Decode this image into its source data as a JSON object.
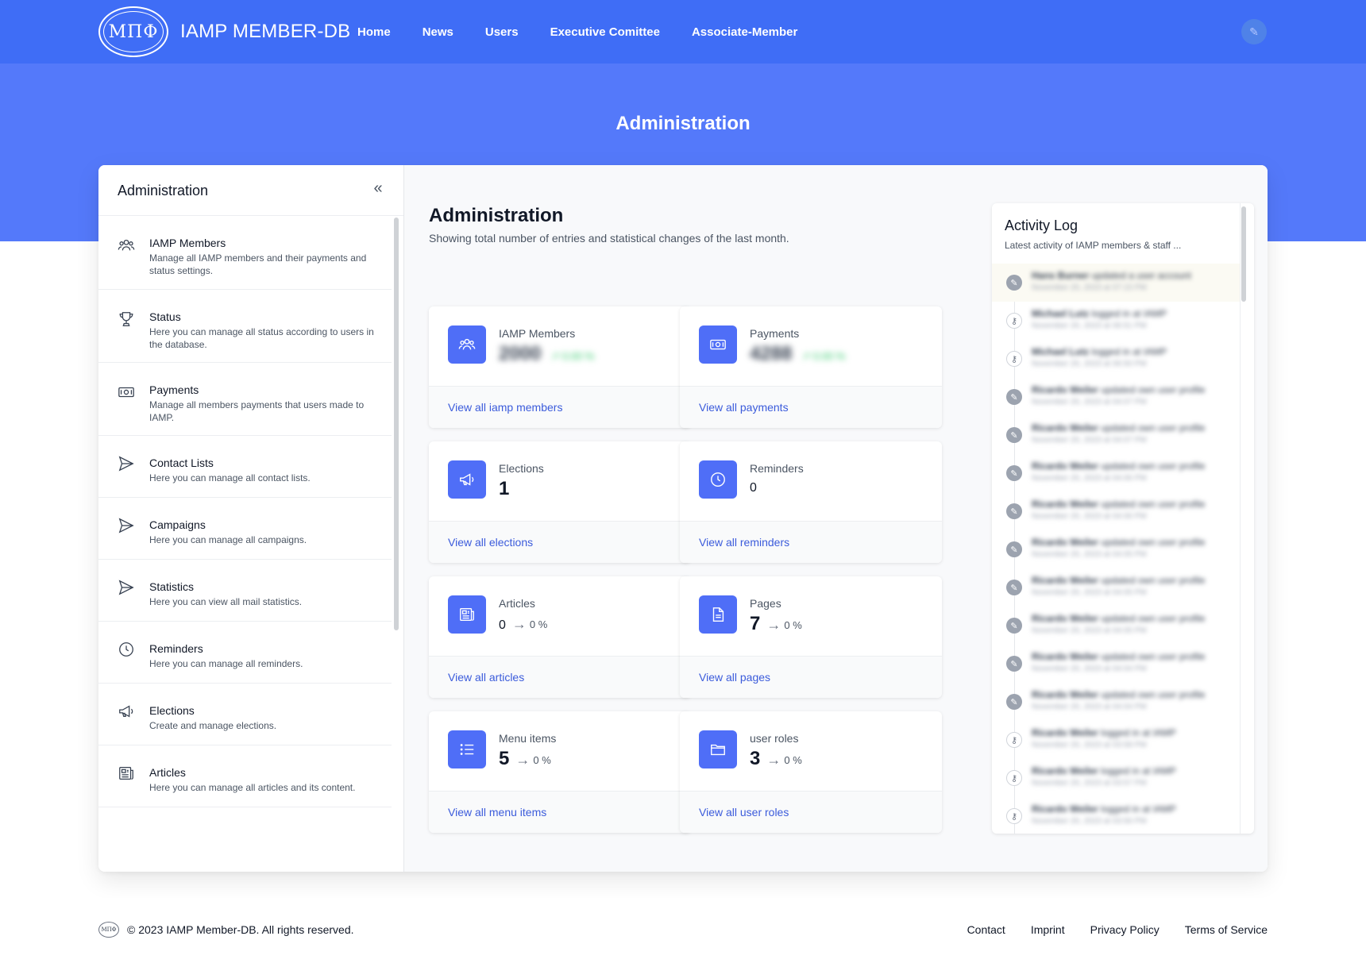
{
  "header": {
    "logo_text": "ΜΠΦ",
    "brand": "IAMP MEMBER-DB",
    "nav": [
      "Home",
      "News",
      "Users",
      "Executive Comittee",
      "Associate-Member"
    ]
  },
  "hero": {
    "title": "Administration"
  },
  "sidebar": {
    "title": "Administration",
    "collapse_icon": "«",
    "items": [
      {
        "title": "IAMP Members",
        "desc": "Manage all IAMP members and their payments and status settings.",
        "icon": "users-icon"
      },
      {
        "title": "Status",
        "desc": "Here you can manage all status according to users in the database.",
        "icon": "trophy-icon"
      },
      {
        "title": "Payments",
        "desc": "Manage all members payments that users made to IAMP.",
        "icon": "banknote-icon"
      },
      {
        "title": "Contact Lists",
        "desc": "Here you can manage all contact lists.",
        "icon": "send-icon"
      },
      {
        "title": "Campaigns",
        "desc": "Here you can manage all campaigns.",
        "icon": "send-icon"
      },
      {
        "title": "Statistics",
        "desc": "Here you can view all mail statistics.",
        "icon": "send-icon"
      },
      {
        "title": "Reminders",
        "desc": "Here you can manage all reminders.",
        "icon": "clock-icon"
      },
      {
        "title": "Elections",
        "desc": "Create and manage elections.",
        "icon": "megaphone-icon"
      },
      {
        "title": "Articles",
        "desc": "Here you can manage all articles and its content.",
        "icon": "newspaper-icon"
      }
    ]
  },
  "main": {
    "title": "Administration",
    "subtitle": "Showing total number of entries and statistical changes of the last month.",
    "cards": [
      {
        "label": "IAMP Members",
        "value": "2000",
        "change": "",
        "link": "View all iamp members",
        "icon": "users-icon",
        "blurred": true,
        "blur_note": "↗ 0.00 %"
      },
      {
        "label": "Payments",
        "value": "4288",
        "change": "",
        "link": "View all payments",
        "icon": "banknote-icon",
        "blurred": true,
        "blur_note": "↗ 0.00 %"
      },
      {
        "label": "Elections",
        "value": "1",
        "change": "",
        "link": "View all elections",
        "icon": "megaphone-icon"
      },
      {
        "label": "Reminders",
        "value": "0",
        "change": "",
        "link": "View all reminders",
        "icon": "clock-icon",
        "small": true
      },
      {
        "label": "Articles",
        "value": "0",
        "change": "0 %",
        "link": "View all articles",
        "icon": "newspaper-icon",
        "small": true
      },
      {
        "label": "Pages",
        "value": "7",
        "change": "0 %",
        "link": "View all pages",
        "icon": "document-icon"
      },
      {
        "label": "Menu items",
        "value": "5",
        "change": "0 %",
        "link": "View all menu items",
        "icon": "list-icon"
      },
      {
        "label": "user roles",
        "value": "3",
        "change": "0 %",
        "link": "View all user roles",
        "icon": "folder-icon"
      }
    ]
  },
  "activity": {
    "title": "Activity Log",
    "subtitle": "Latest activity of IAMP members & staff ...",
    "entries": [
      {
        "type": "edit",
        "name": "Hans Burner",
        "action": "updated a user account",
        "time": "November 20, 2023 at 07:15 PM"
      },
      {
        "type": "key",
        "name": "Michael Lutz",
        "action": "logged in at IAMP",
        "time": "November 20, 2023 at 06:51 PM"
      },
      {
        "type": "key",
        "name": "Michael Lutz",
        "action": "logged in at IAMP",
        "time": "November 20, 2023 at 06:50 PM"
      },
      {
        "type": "edit",
        "name": "Ricardo Weiler",
        "action": "updated own user profile",
        "time": "November 20, 2023 at 04:07 PM"
      },
      {
        "type": "edit",
        "name": "Ricardo Weiler",
        "action": "updated own user profile",
        "time": "November 20, 2023 at 04:07 PM"
      },
      {
        "type": "edit",
        "name": "Ricardo Weiler",
        "action": "updated own user profile",
        "time": "November 20, 2023 at 04:06 PM"
      },
      {
        "type": "edit",
        "name": "Ricardo Weiler",
        "action": "updated own user profile",
        "time": "November 20, 2023 at 04:06 PM"
      },
      {
        "type": "edit",
        "name": "Ricardo Weiler",
        "action": "updated own user profile",
        "time": "November 20, 2023 at 04:05 PM"
      },
      {
        "type": "edit",
        "name": "Ricardo Weiler",
        "action": "updated own user profile",
        "time": "November 20, 2023 at 04:05 PM"
      },
      {
        "type": "edit",
        "name": "Ricardo Weiler",
        "action": "updated own user profile",
        "time": "November 20, 2023 at 04:05 PM"
      },
      {
        "type": "edit",
        "name": "Ricardo Weiler",
        "action": "updated own user profile",
        "time": "November 20, 2023 at 04:04 PM"
      },
      {
        "type": "edit",
        "name": "Ricardo Weiler",
        "action": "updated own user profile",
        "time": "November 20, 2023 at 04:04 PM"
      },
      {
        "type": "key",
        "name": "Ricardo Weiler",
        "action": "logged in at IAMP",
        "time": "November 20, 2023 at 03:58 PM"
      },
      {
        "type": "key",
        "name": "Ricardo Weiler",
        "action": "logged in at IAMP",
        "time": "November 20, 2023 at 03:57 PM"
      },
      {
        "type": "key",
        "name": "Ricardo Weiler",
        "action": "logged in at IAMP",
        "time": "November 20, 2023 at 03:56 PM"
      }
    ]
  },
  "footer": {
    "logo_text": "ΜΠΦ",
    "copyright": "© 2023 IAMP Member-DB. All rights reserved.",
    "links": [
      "Contact",
      "Imprint",
      "Privacy Policy",
      "Terms of Service"
    ]
  },
  "colors": {
    "primary": "#3f6df6",
    "hero": "#5479fa",
    "accent_icon": "#4f6ef7",
    "link": "#3b5bdb"
  }
}
